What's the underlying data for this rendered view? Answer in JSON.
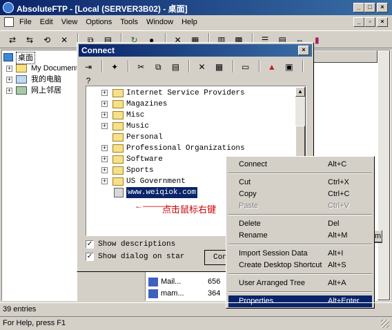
{
  "window": {
    "title": "AbsoluteFTP - [Local (SERVER3B02) - 桌面]"
  },
  "menu": [
    "File",
    "Edit",
    "View",
    "Options",
    "Tools",
    "Window",
    "Help"
  ],
  "left_tree": [
    "桌面",
    "My Document",
    "我的电脑",
    "网上邻居"
  ],
  "connect_dialog": {
    "title": "Connect",
    "folders": [
      "Internet Service Providers",
      "Magazines",
      "Misc",
      "Music",
      "Personal",
      "Professional Organizations",
      "Software",
      "Sports",
      "US Government"
    ],
    "selected_site": "www.weiqiok.com",
    "annotation": "点击鼠标右键",
    "annotation_arrow": "←————",
    "show_descriptions": "Show descriptions",
    "show_dialog": "Show dialog on star",
    "connect_button": "Con",
    "side_button": "m"
  },
  "context_menu": [
    {
      "label": "Connect",
      "shortcut": "Alt+C"
    },
    {
      "sep": true
    },
    {
      "label": "Cut",
      "shortcut": "Ctrl+X"
    },
    {
      "label": "Copy",
      "shortcut": "Ctrl+C"
    },
    {
      "label": "Paste",
      "shortcut": "Ctrl+V",
      "disabled": true
    },
    {
      "sep": true
    },
    {
      "label": "Delete",
      "shortcut": "Del"
    },
    {
      "label": "Rename",
      "shortcut": "Alt+M"
    },
    {
      "sep": true
    },
    {
      "label": "Import Session Data",
      "shortcut": "Alt+I"
    },
    {
      "label": "Create Desktop Shortcut",
      "shortcut": "Alt+S"
    },
    {
      "sep": true
    },
    {
      "label": "User Arranged Tree",
      "shortcut": "Alt+A"
    },
    {
      "sep": true
    },
    {
      "label": "Properties",
      "shortcut": "Alt+Enter",
      "highlighted": true
    }
  ],
  "file_list": [
    {
      "name": "Mail...",
      "size": "656"
    },
    {
      "name": "mam...",
      "size": "364"
    }
  ],
  "status": {
    "entries": "39 entries",
    "help": "For Help, press F1"
  },
  "colors": {
    "highlight": "#0a246a",
    "titlebar": "#0a246a",
    "face": "#d4d0c8",
    "annotation": "#cc0000"
  }
}
